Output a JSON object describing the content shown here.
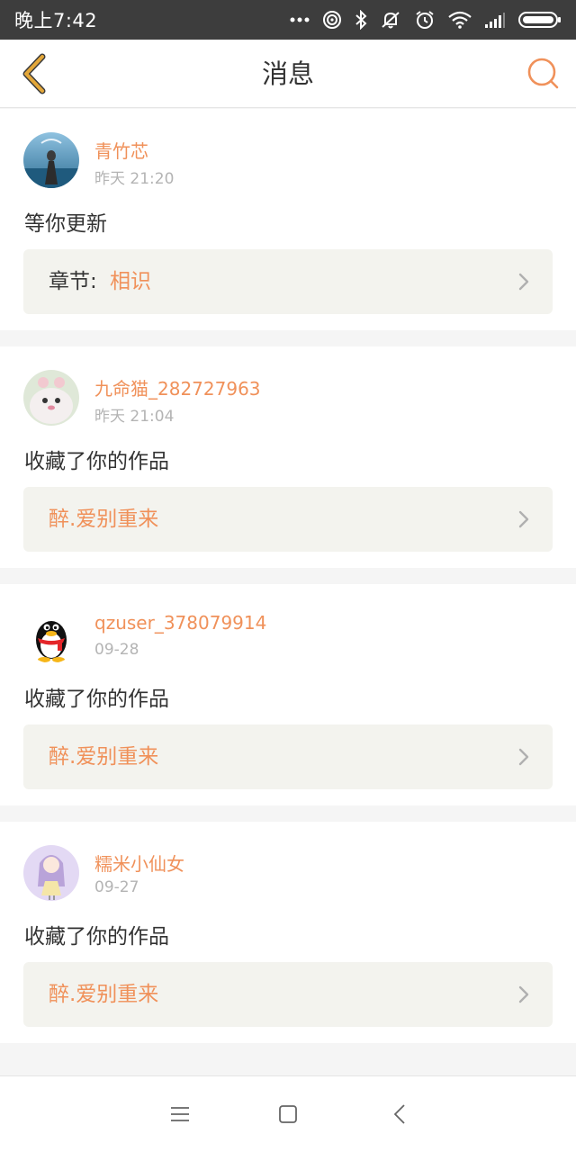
{
  "status_bar": {
    "time": "晚上7:42",
    "icons": [
      "more-dots-icon",
      "hotspot-icon",
      "bluetooth-icon",
      "mute-icon",
      "alarm-icon",
      "wifi-icon",
      "signal-icon",
      "battery-icon"
    ]
  },
  "header": {
    "title": "消息",
    "back_icon": "chevron-left-icon",
    "search_icon": "search-icon"
  },
  "colors": {
    "accent": "#f0915a",
    "back_arrow": "#e3a73a",
    "ref_bg": "#f3f3ee"
  },
  "messages": [
    {
      "username": "青竹芯",
      "time": "昨天 21:20",
      "text": "等你更新",
      "ref_label": "章节:",
      "ref_link": "相识"
    },
    {
      "username": "九命猫_282727963",
      "time": "昨天 21:04",
      "text": "收藏了你的作品",
      "ref_label": "",
      "ref_link": "醉.爱别重来"
    },
    {
      "username": "qzuser_378079914",
      "time": "09-28",
      "text": "收藏了你的作品",
      "ref_label": "",
      "ref_link": "醉.爱别重来"
    },
    {
      "username": "糯米小仙女",
      "time": "09-27",
      "text": "收藏了你的作品",
      "ref_label": "",
      "ref_link": "醉.爱别重来"
    }
  ],
  "system_nav": {
    "buttons": [
      "menu-icon",
      "home-icon",
      "back-icon"
    ]
  }
}
